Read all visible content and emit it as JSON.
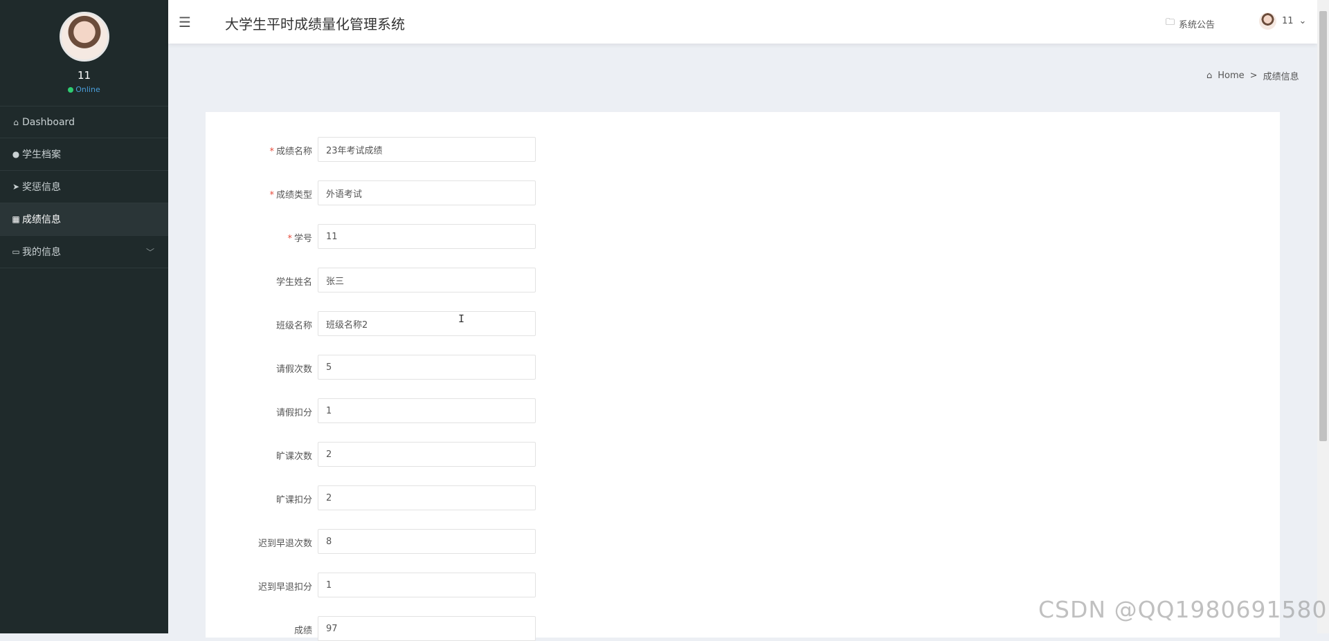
{
  "sidebar": {
    "username": "11",
    "status": "Online",
    "items": [
      {
        "label": "Dashboard",
        "icon": "home-icon"
      },
      {
        "label": "学生档案",
        "icon": "user-icon"
      },
      {
        "label": "奖惩信息",
        "icon": "send-icon"
      },
      {
        "label": "成绩信息",
        "icon": "grid-icon",
        "active": true
      },
      {
        "label": "我的信息",
        "icon": "card-icon",
        "has_submenu": true
      }
    ]
  },
  "topbar": {
    "title": "大学生平时成绩量化管理系统",
    "notice": "系统公告",
    "user": "11"
  },
  "breadcrumb": {
    "home": "Home",
    "separator": ">",
    "current": "成绩信息"
  },
  "form": {
    "fields": [
      {
        "label": "成绩名称",
        "required": true,
        "value": "23年考试成绩"
      },
      {
        "label": "成绩类型",
        "required": true,
        "value": "外语考试"
      },
      {
        "label": "学号",
        "required": true,
        "value": "11"
      },
      {
        "label": "学生姓名",
        "required": false,
        "value": "张三"
      },
      {
        "label": "班级名称",
        "required": false,
        "value": "班级名称2"
      },
      {
        "label": "请假次数",
        "required": false,
        "value": "5"
      },
      {
        "label": "请假扣分",
        "required": false,
        "value": "1"
      },
      {
        "label": "旷课次数",
        "required": false,
        "value": "2"
      },
      {
        "label": "旷课扣分",
        "required": false,
        "value": "2"
      },
      {
        "label": "迟到早退次数",
        "required": false,
        "value": "8"
      },
      {
        "label": "迟到早退扣分",
        "required": false,
        "value": "1"
      },
      {
        "label": "成绩",
        "required": false,
        "value": "97"
      }
    ]
  },
  "watermark": "CSDN @QQ1980691580"
}
